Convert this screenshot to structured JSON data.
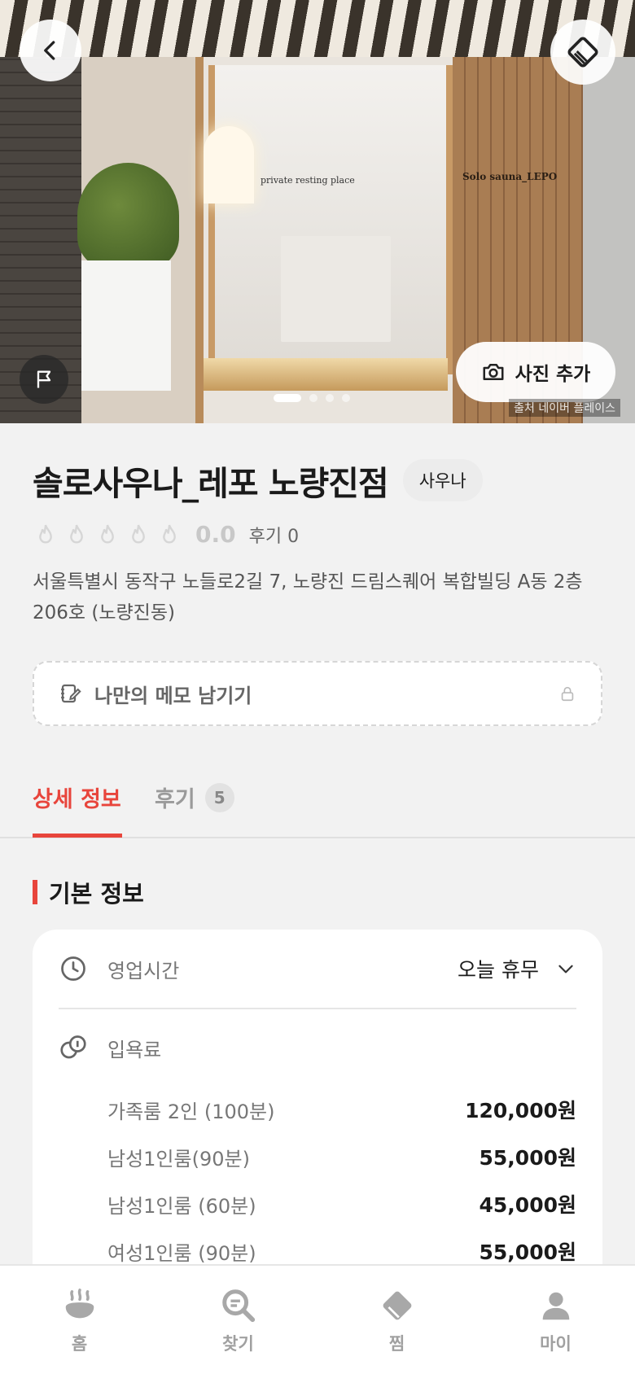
{
  "hero": {
    "sign_text": "private resting place",
    "brand_text": "Solo sauna_LEPO",
    "add_photo_label": "사진 추가",
    "source_label": "출처 네이버 플레이스",
    "slide_count": 4,
    "active_slide": 1
  },
  "place": {
    "name": "솔로사우나_레포 노량진점",
    "category": "사우나",
    "rating": "0.0",
    "review_label": "후기 0",
    "address": "서울특별시 동작구 노들로2길 7, 노량진 드림스퀘어 복합빌딩 A동 2층 206호 (노량진동)"
  },
  "memo": {
    "label": "나만의 메모 남기기"
  },
  "tabs": {
    "detail_label": "상세 정보",
    "review_label": "후기",
    "review_count": "5"
  },
  "section": {
    "title": "기본 정보"
  },
  "info": {
    "hours_label": "영업시간",
    "hours_value": "오늘 휴무",
    "fee_label": "입욕료",
    "fees": [
      {
        "name": "가족룸 2인 (100분)",
        "price": "120,000원"
      },
      {
        "name": "남성1인룸(90분)",
        "price": "55,000원"
      },
      {
        "name": "남성1인룸 (60분)",
        "price": "45,000원"
      },
      {
        "name": "여성1인룸 (90분)",
        "price": "55,000원"
      }
    ]
  },
  "nav": {
    "home": "홈",
    "search": "찾기",
    "saved": "찜",
    "my": "마이"
  },
  "colors": {
    "accent": "#e8453c",
    "muted": "#9a9a9a"
  }
}
